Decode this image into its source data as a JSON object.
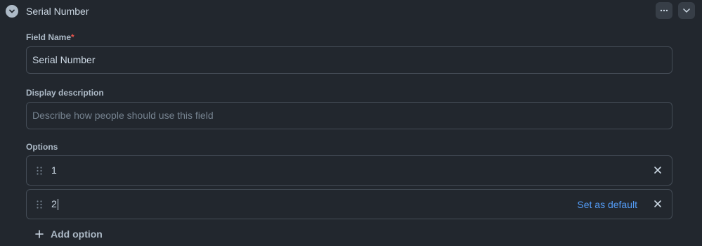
{
  "header": {
    "title": "Serial Number",
    "collapse_icon": "chevron-down-icon",
    "more_icon": "kebab-horizontal-icon",
    "expand_icon": "chevron-down-icon"
  },
  "field_name": {
    "label": "Field Name",
    "required_mark": "*",
    "value": "Serial Number"
  },
  "display_description": {
    "label": "Display description",
    "placeholder": "Describe how people should use this field"
  },
  "options": {
    "label": "Options",
    "items": [
      {
        "value": "1"
      },
      {
        "value": "2",
        "set_default_label": "Set as default"
      }
    ],
    "add_label": "Add option"
  },
  "colors": {
    "background": "#22272e",
    "border": "#444c56",
    "link": "#539bf5",
    "required": "#e5534b"
  }
}
